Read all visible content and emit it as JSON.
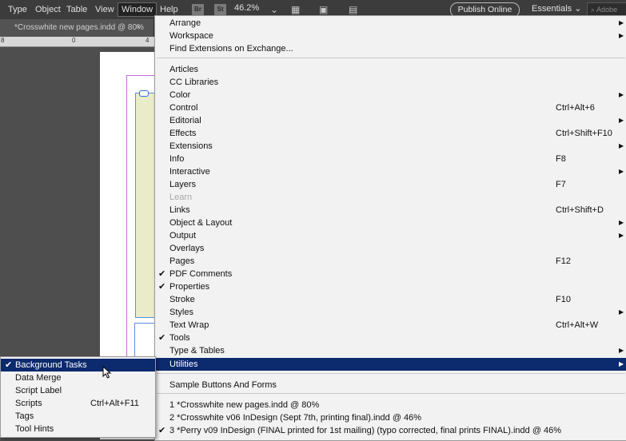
{
  "menubar": {
    "items": [
      "Type",
      "Object",
      "Table",
      "View",
      "Window",
      "Help"
    ],
    "bridge_label": "Br",
    "stock_label": "St",
    "zoom": "46.2%",
    "publish_label": "Publish Online",
    "workspace": "Essentials",
    "search_placeholder": "Adobe"
  },
  "tab": {
    "title": "*Crosswhite new pages.indd @ 80%",
    "close": "×"
  },
  "ruler": {
    "ticks": [
      "8",
      "0",
      "4"
    ]
  },
  "window_menu": {
    "items": [
      {
        "label": "Arrange",
        "shortcut": "",
        "submenu": true,
        "checked": false,
        "disabled": false
      },
      {
        "label": "Workspace",
        "shortcut": "",
        "submenu": true,
        "checked": false,
        "disabled": false
      },
      {
        "label": "Find Extensions on Exchange...",
        "shortcut": "",
        "submenu": false,
        "checked": false,
        "disabled": false
      },
      {
        "label": "Articles",
        "shortcut": "",
        "submenu": false,
        "checked": false,
        "disabled": false
      },
      {
        "label": "CC Libraries",
        "shortcut": "",
        "submenu": false,
        "checked": false,
        "disabled": false
      },
      {
        "label": "Color",
        "shortcut": "",
        "submenu": true,
        "checked": false,
        "disabled": false
      },
      {
        "label": "Control",
        "shortcut": "Ctrl+Alt+6",
        "submenu": false,
        "checked": false,
        "disabled": false
      },
      {
        "label": "Editorial",
        "shortcut": "",
        "submenu": true,
        "checked": false,
        "disabled": false
      },
      {
        "label": "Effects",
        "shortcut": "Ctrl+Shift+F10",
        "submenu": false,
        "checked": false,
        "disabled": false
      },
      {
        "label": "Extensions",
        "shortcut": "",
        "submenu": true,
        "checked": false,
        "disabled": false
      },
      {
        "label": "Info",
        "shortcut": "F8",
        "submenu": false,
        "checked": false,
        "disabled": false
      },
      {
        "label": "Interactive",
        "shortcut": "",
        "submenu": true,
        "checked": false,
        "disabled": false
      },
      {
        "label": "Layers",
        "shortcut": "F7",
        "submenu": false,
        "checked": false,
        "disabled": false
      },
      {
        "label": "Learn",
        "shortcut": "",
        "submenu": false,
        "checked": false,
        "disabled": true
      },
      {
        "label": "Links",
        "shortcut": "Ctrl+Shift+D",
        "submenu": false,
        "checked": false,
        "disabled": false
      },
      {
        "label": "Object & Layout",
        "shortcut": "",
        "submenu": true,
        "checked": false,
        "disabled": false
      },
      {
        "label": "Output",
        "shortcut": "",
        "submenu": true,
        "checked": false,
        "disabled": false
      },
      {
        "label": "Overlays",
        "shortcut": "",
        "submenu": false,
        "checked": false,
        "disabled": false
      },
      {
        "label": "Pages",
        "shortcut": "F12",
        "submenu": false,
        "checked": false,
        "disabled": false
      },
      {
        "label": "PDF Comments",
        "shortcut": "",
        "submenu": false,
        "checked": true,
        "disabled": false
      },
      {
        "label": "Properties",
        "shortcut": "",
        "submenu": false,
        "checked": true,
        "disabled": false
      },
      {
        "label": "Stroke",
        "shortcut": "F10",
        "submenu": false,
        "checked": false,
        "disabled": false
      },
      {
        "label": "Styles",
        "shortcut": "",
        "submenu": true,
        "checked": false,
        "disabled": false
      },
      {
        "label": "Text Wrap",
        "shortcut": "Ctrl+Alt+W",
        "submenu": false,
        "checked": false,
        "disabled": false
      },
      {
        "label": "Tools",
        "shortcut": "",
        "submenu": false,
        "checked": true,
        "disabled": false
      },
      {
        "label": "Type & Tables",
        "shortcut": "",
        "submenu": true,
        "checked": false,
        "disabled": false
      },
      {
        "label": "Utilities",
        "shortcut": "",
        "submenu": true,
        "checked": false,
        "disabled": false,
        "highlighted": true
      },
      {
        "label": "Sample Buttons And Forms",
        "shortcut": "",
        "submenu": false,
        "checked": false,
        "disabled": false
      },
      {
        "label": "1 *Crosswhite new pages.indd @ 80%",
        "shortcut": "",
        "submenu": false,
        "checked": false,
        "disabled": false
      },
      {
        "label": "2 *Crosswhite v06 InDesign (Sept 7th, printing final).indd @ 46%",
        "shortcut": "",
        "submenu": false,
        "checked": false,
        "disabled": false
      },
      {
        "label": "3 *Perry v09 InDesign (FINAL printed for 1st mailing) (typo corrected, final prints FINAL).indd @ 46%",
        "shortcut": "",
        "submenu": false,
        "checked": true,
        "disabled": false
      }
    ]
  },
  "utilities_menu": {
    "items": [
      {
        "label": "Background Tasks",
        "shortcut": "",
        "checked": true,
        "highlighted": true
      },
      {
        "label": "Data Merge",
        "shortcut": "",
        "checked": false
      },
      {
        "label": "Script Label",
        "shortcut": "",
        "checked": false
      },
      {
        "label": "Scripts",
        "shortcut": "Ctrl+Alt+F11",
        "checked": false
      },
      {
        "label": "Tags",
        "shortcut": "",
        "checked": false
      },
      {
        "label": "Tool Hints",
        "shortcut": "",
        "checked": false
      }
    ]
  },
  "colors": {
    "highlight": "#0c2a6e",
    "menubar": "#3c3c3c",
    "menu_bg": "#f2f2f2"
  }
}
